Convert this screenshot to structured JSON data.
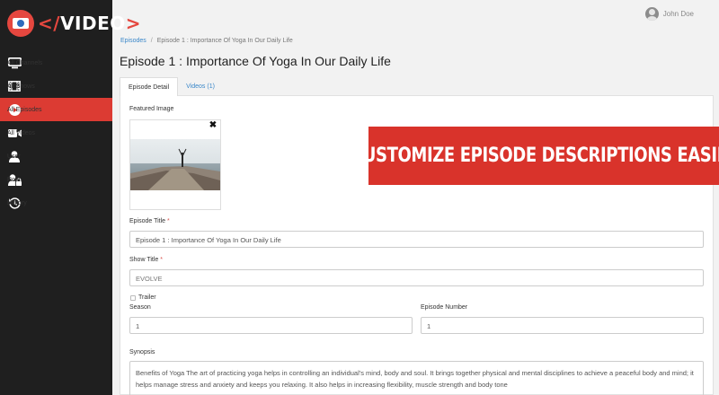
{
  "logo": {
    "prefix": "</",
    "text": "VIDEO",
    "suffix": ">"
  },
  "sidebar": {
    "items": [
      {
        "label": "All Channels",
        "icon": "monitor-icon",
        "active": false
      },
      {
        "label": "All Shows",
        "icon": "film-icon",
        "active": false
      },
      {
        "label": "All Episodes",
        "icon": "play-icon",
        "active": true
      },
      {
        "label": "All Videos",
        "icon": "video-camera-icon",
        "active": false
      },
      {
        "label": "User",
        "icon": "user-icon",
        "active": false
      },
      {
        "label": "Role",
        "icon": "user-lock-icon",
        "active": false
      },
      {
        "label": "History",
        "icon": "history-icon",
        "active": false
      }
    ]
  },
  "header": {
    "user_name": "John Doe"
  },
  "breadcrumb": {
    "link": "Episodes",
    "separator": "/",
    "current": "Episode 1 : Importance Of Yoga In Our Daily Life"
  },
  "page_title": "Episode 1 : Importance Of Yoga In Our Daily Life",
  "tabs": [
    {
      "label": "Episode Detail",
      "active": true
    },
    {
      "label": "Videos (1)",
      "active": false
    }
  ],
  "form": {
    "featured_image_label": "Featured Image",
    "remove_glyph": "✖",
    "episode_title_label": "Episode Title",
    "episode_title_value": "Episode 1 :  Importance Of Yoga In Our Daily Life",
    "show_title_label": "Show Title",
    "show_title_value": "EVOLVE",
    "required_mark": "*",
    "trailer_label": "Trailer",
    "season_label": "Season",
    "season_value": "1",
    "episode_number_label": "Episode Number",
    "episode_number_value": "1",
    "synopsis_label": "Synopsis",
    "synopsis_value": "Benefits of Yoga The art of practicing yoga helps in controlling an individual's mind, body and soul. It brings together physical and mental disciplines to achieve a peaceful body and mind; it helps manage stress and anxiety and keeps you relaxing. It also helps in increasing flexibility, muscle strength and body tone"
  },
  "banner": {
    "text": "CUSTOMIZE EPISODE DESCRIPTIONS EASILY"
  },
  "colors": {
    "accent": "#dc3b33",
    "sidebar_bg": "#1f1f1f",
    "link": "#3a87c9"
  }
}
